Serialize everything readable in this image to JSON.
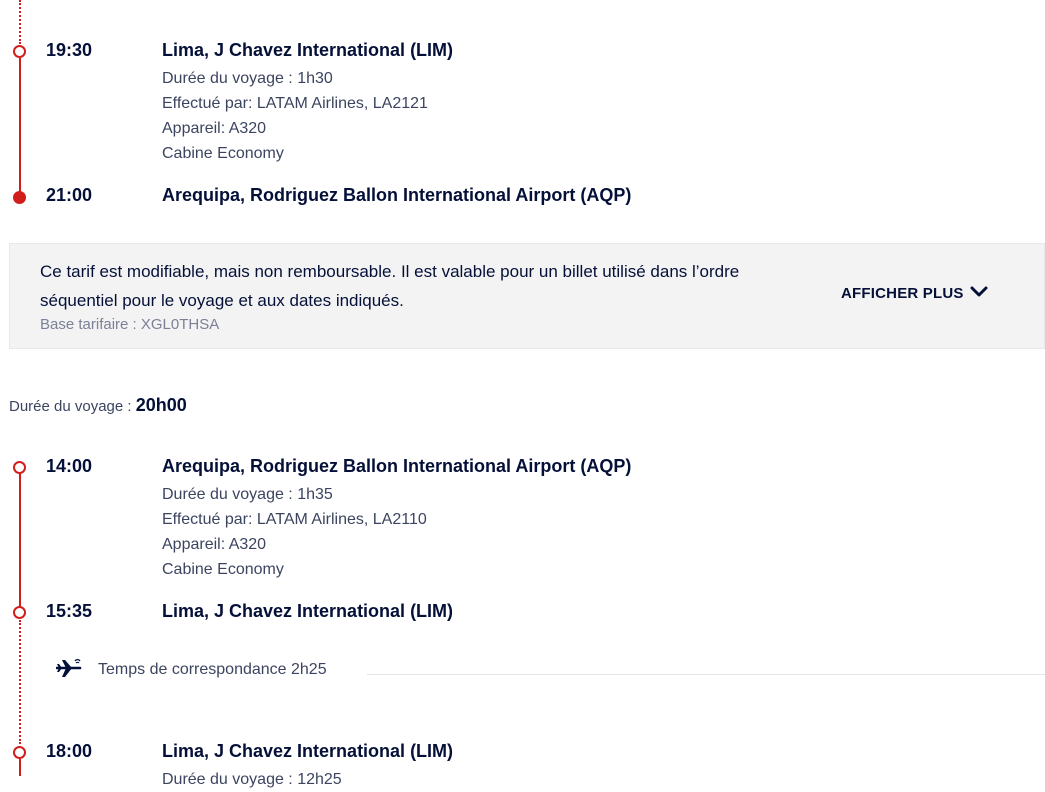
{
  "segment1": {
    "departure": {
      "time": "19:30",
      "airport": "Lima, J Chavez International (LIM)"
    },
    "details": {
      "duration": "Durée du voyage : 1h30",
      "operated_by": "Effectué par: LATAM Airlines, LA2121",
      "aircraft": "Appareil: A320",
      "cabin": "Cabine Economy"
    },
    "arrival": {
      "time": "21:00",
      "airport": "Arequipa, Rodriguez Ballon International Airport (AQP)"
    }
  },
  "fare": {
    "text": "Ce tarif est modifiable, mais non remboursable. Il est valable pour un billet utilisé dans l’ordre séquentiel pour le voyage et aux dates indiqués.",
    "base": "Base tarifaire : XGL0THSA",
    "more_label": "AFFICHER PLUS"
  },
  "return_trip": {
    "duration_label": "Durée du voyage : ",
    "duration_value": "20h00"
  },
  "segment2": {
    "departure": {
      "time": "14:00",
      "airport": "Arequipa, Rodriguez Ballon International Airport (AQP)"
    },
    "details": {
      "duration": "Durée du voyage : 1h35",
      "operated_by": "Effectué par: LATAM Airlines, LA2110",
      "aircraft": "Appareil: A320",
      "cabin": "Cabine Economy"
    },
    "arrival": {
      "time": "15:35",
      "airport": "Lima, J Chavez International (LIM)"
    }
  },
  "connection": {
    "icon": "connection-plane-icon",
    "text": "Temps de correspondance 2h25"
  },
  "segment3": {
    "departure": {
      "time": "18:00",
      "airport": "Lima, J Chavez International (LIM)"
    },
    "details": {
      "duration_partial": "Durée du voyage : 12h25"
    }
  },
  "colors": {
    "accent": "#d21d1d",
    "text": "#051039",
    "muted": "#3c4460",
    "fare_bg": "#f3f3f3"
  }
}
